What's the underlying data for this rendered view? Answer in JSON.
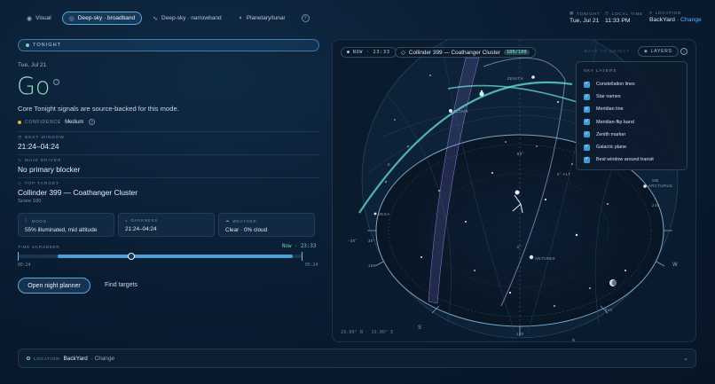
{
  "modes": [
    {
      "label": "Visual",
      "icon": "eye-icon",
      "active": false
    },
    {
      "label": "Deep-sky · broadband",
      "icon": "galaxy-icon",
      "active": true
    },
    {
      "label": "Deep-sky · narrowband",
      "icon": "wave-icon",
      "active": false
    },
    {
      "label": "Planetary/lunar",
      "icon": "planet-icon",
      "active": false
    }
  ],
  "header": {
    "tonight_label": "TONIGHT",
    "tonight_value": "Tue, Jul 21",
    "local_time_label": "LOCAL TIME",
    "local_time_value": "11:33 PM",
    "location_label": "LOCATION",
    "location_value": "BackYard",
    "location_change": "Change"
  },
  "summary": {
    "pill": "TONIGHT",
    "date": "Tue, Jul 21",
    "verdict": "Go",
    "subline": "Core Tonight signals are source-backed for this mode.",
    "confidence_label": "CONFIDENCE",
    "confidence_value": "Medium",
    "best_window_label": "BEST WINDOW",
    "best_window_value": "21:24–04:24",
    "main_driver_label": "MAIN DRIVER",
    "main_driver_value": "No primary blocker",
    "top_target_label": "TOP TARGET",
    "top_target_value": "Collinder 399 — Coathanger Cluster",
    "top_target_score": "Score 100"
  },
  "cards": [
    {
      "label": "MOON",
      "value": "55% illuminated, mid altitude"
    },
    {
      "label": "DARKNESS",
      "value": "21:24–04:24"
    },
    {
      "label": "WEATHER",
      "value": "Clear · 0% cloud"
    }
  ],
  "scrubber": {
    "label": "TIME SCRUBBER",
    "now": "Now · 23:33",
    "start": "00:24",
    "end": "05:24",
    "position": 0.4
  },
  "actions": {
    "primary": "Open night planner",
    "secondary": "Find targets"
  },
  "sky": {
    "now_chip": "NOW · 23:33",
    "target": "Collinder 399 — Coathanger Cluster",
    "score": "100/100",
    "back_label": "BACK TO OBJECT",
    "layers_label": "LAYERS",
    "layers_title": "SKY LAYERS",
    "layers": [
      "Constellation lines",
      "Star names",
      "Meridian line",
      "Meridian-flip band",
      "Zenith marker",
      "Galactic plane",
      "Best window around transit"
    ],
    "coords": "29.00° N · 19.00° E",
    "labels": {
      "zenith": "ZENITH",
      "vega": "VEGA",
      "antares": "ANTARES",
      "arcturus": "ARCTURUS",
      "altair": "ALTAIR",
      "e": "E",
      "s": "S",
      "w": "W",
      "n": "N",
      "sw": "SW",
      "alt60": "60°",
      "alt30": "30°",
      "alt0": "0°",
      "alt_neg": "-30°",
      "az60": "60",
      "az120": "120",
      "az150": "150",
      "az210": "210",
      "az240": "240",
      "az300": "300",
      "az330": "330",
      "alt_mark": "0° ALT",
      "alt_mark2": "60° ALT"
    }
  },
  "location_bar": {
    "label": "LOCATION",
    "name": "BackYard",
    "change": "· Change"
  }
}
